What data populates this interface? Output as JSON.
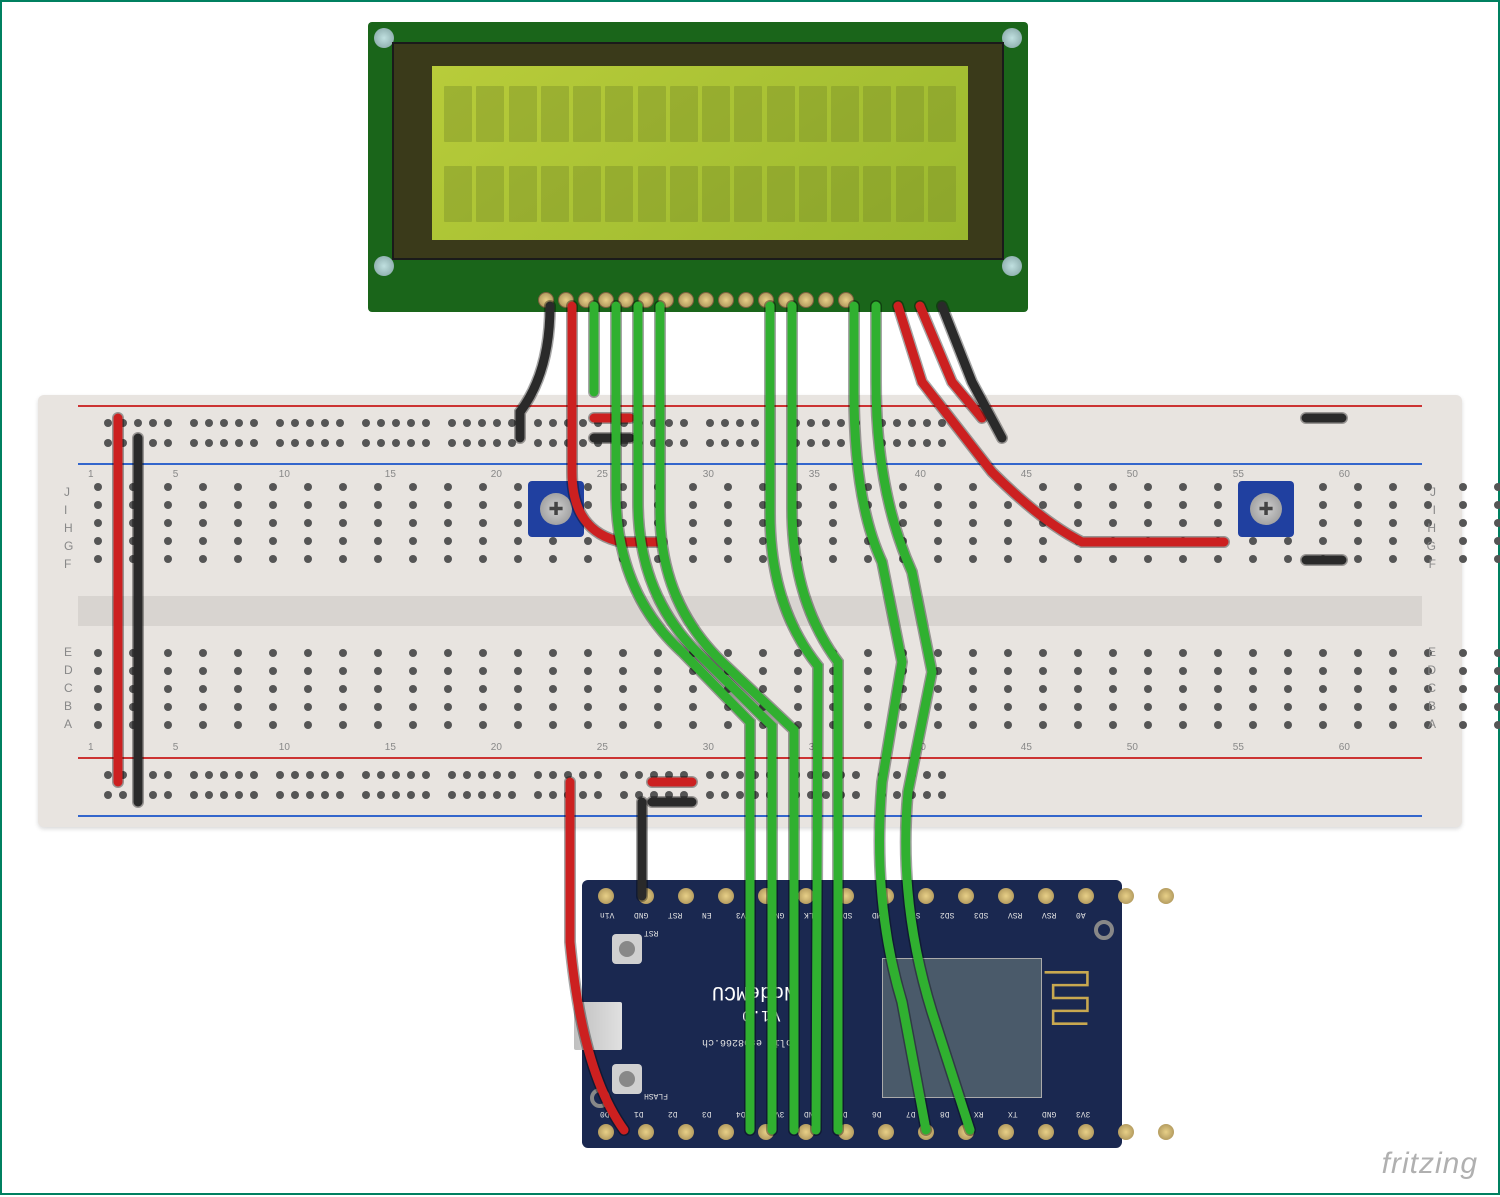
{
  "lcd": {
    "pin_count": 16,
    "char_cols": 16,
    "char_rows": 2
  },
  "breadboard": {
    "row_labels_top": [
      "J",
      "I",
      "H",
      "G",
      "F"
    ],
    "row_labels_bottom": [
      "E",
      "D",
      "C",
      "B",
      "A"
    ],
    "col_numbers": [
      1,
      5,
      10,
      15,
      20,
      25,
      30,
      35,
      40,
      45,
      50,
      55,
      60
    ],
    "rail_plus": "+",
    "rail_minus": "−"
  },
  "nodemcu": {
    "title": "NodeMCU",
    "subtitle": "V1.0",
    "vendor": "Lolin esp8266.ch",
    "button_rst": "RST",
    "button_flash": "FLASH",
    "top_pins": [
      "Vin",
      "GND",
      "RST",
      "EN",
      "3V3",
      "GND",
      "CLK",
      "SD0",
      "CMD",
      "SD1",
      "SD2",
      "SD3",
      "RSV",
      "RSV",
      "A0"
    ],
    "bottom_pins": [
      "D0",
      "D1",
      "D2",
      "D3",
      "D4",
      "3V3",
      "GND",
      "D5",
      "D6",
      "D7",
      "D8",
      "RX",
      "TX",
      "GND",
      "3V3"
    ]
  },
  "watermark": "fritzing"
}
